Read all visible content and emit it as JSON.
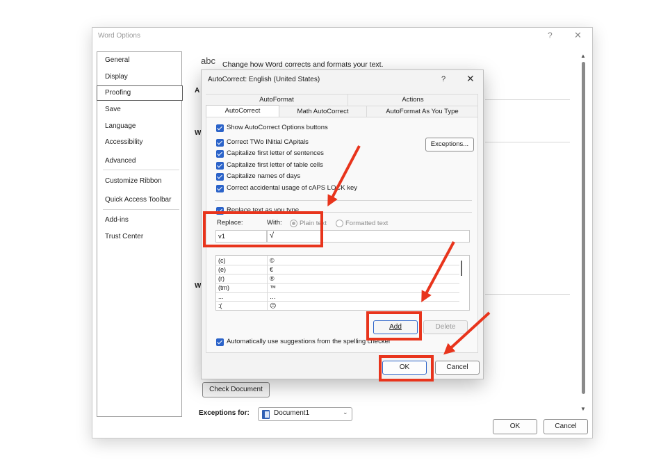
{
  "window": {
    "title": "Word Options",
    "help_glyph": "?",
    "close_glyph": "✕"
  },
  "nav": {
    "items": [
      {
        "label": "General"
      },
      {
        "label": "Display"
      },
      {
        "label": "Proofing",
        "selected": true
      },
      {
        "label": "Save"
      },
      {
        "label": "Language"
      },
      {
        "label": "Accessibility"
      },
      {
        "label": "Advanced"
      },
      {
        "label": "Customize Ribbon"
      },
      {
        "label": "Quick Access Toolbar"
      },
      {
        "label": "Add-ins"
      },
      {
        "label": "Trust Center"
      }
    ]
  },
  "proofing": {
    "icon_text": "abc",
    "description": "Change how Word corrects and formats your text.",
    "section_letters": [
      "A",
      "W",
      "W"
    ],
    "check_document_label": "Check Document",
    "exceptions_label": "Exceptions for:",
    "document_select": "Document1"
  },
  "footer": {
    "ok_label": "OK",
    "cancel_label": "Cancel"
  },
  "autocorrect": {
    "title": "AutoCorrect: English (United States)",
    "help_glyph": "?",
    "close_glyph": "✕",
    "tabs_row1": [
      "AutoFormat",
      "Actions"
    ],
    "tabs_row2": [
      "AutoCorrect",
      "Math AutoCorrect",
      "AutoFormat As You Type"
    ],
    "active_tab": "AutoCorrect",
    "show_buttons_label": "Show AutoCorrect Options buttons",
    "exceptions_label": "Exceptions...",
    "options": [
      {
        "label": "Correct TWo INitial CApitals",
        "checked": true
      },
      {
        "label": "Capitalize first letter of sentences",
        "checked": true
      },
      {
        "label": "Capitalize first letter of table cells",
        "checked": true
      },
      {
        "label": "Capitalize names of days",
        "checked": true
      },
      {
        "label": "Correct accidental usage of cAPS LOCK key",
        "checked": true
      }
    ],
    "replace_as_you_type_label": "Replace text as you type",
    "replace_label": "Replace:",
    "with_label": "With:",
    "plain_text_label": "Plain text",
    "formatted_text_label": "Formatted text",
    "replace_value": "v1",
    "with_value": "√",
    "entries": [
      {
        "replace": "(c)",
        "with": "©"
      },
      {
        "replace": "(e)",
        "with": "€"
      },
      {
        "replace": "(r)",
        "with": "®"
      },
      {
        "replace": "(tm)",
        "with": "™"
      },
      {
        "replace": "...",
        "with": "…"
      },
      {
        "replace": ":(",
        "with": "☹"
      }
    ],
    "add_label": "Add",
    "delete_label": "Delete",
    "auto_suggest_label": "Automatically use suggestions from the spelling checker",
    "ok_label": "OK",
    "cancel_label": "Cancel"
  },
  "colors": {
    "accent": "#2b63c9",
    "annotation_red": "#e8341c"
  }
}
